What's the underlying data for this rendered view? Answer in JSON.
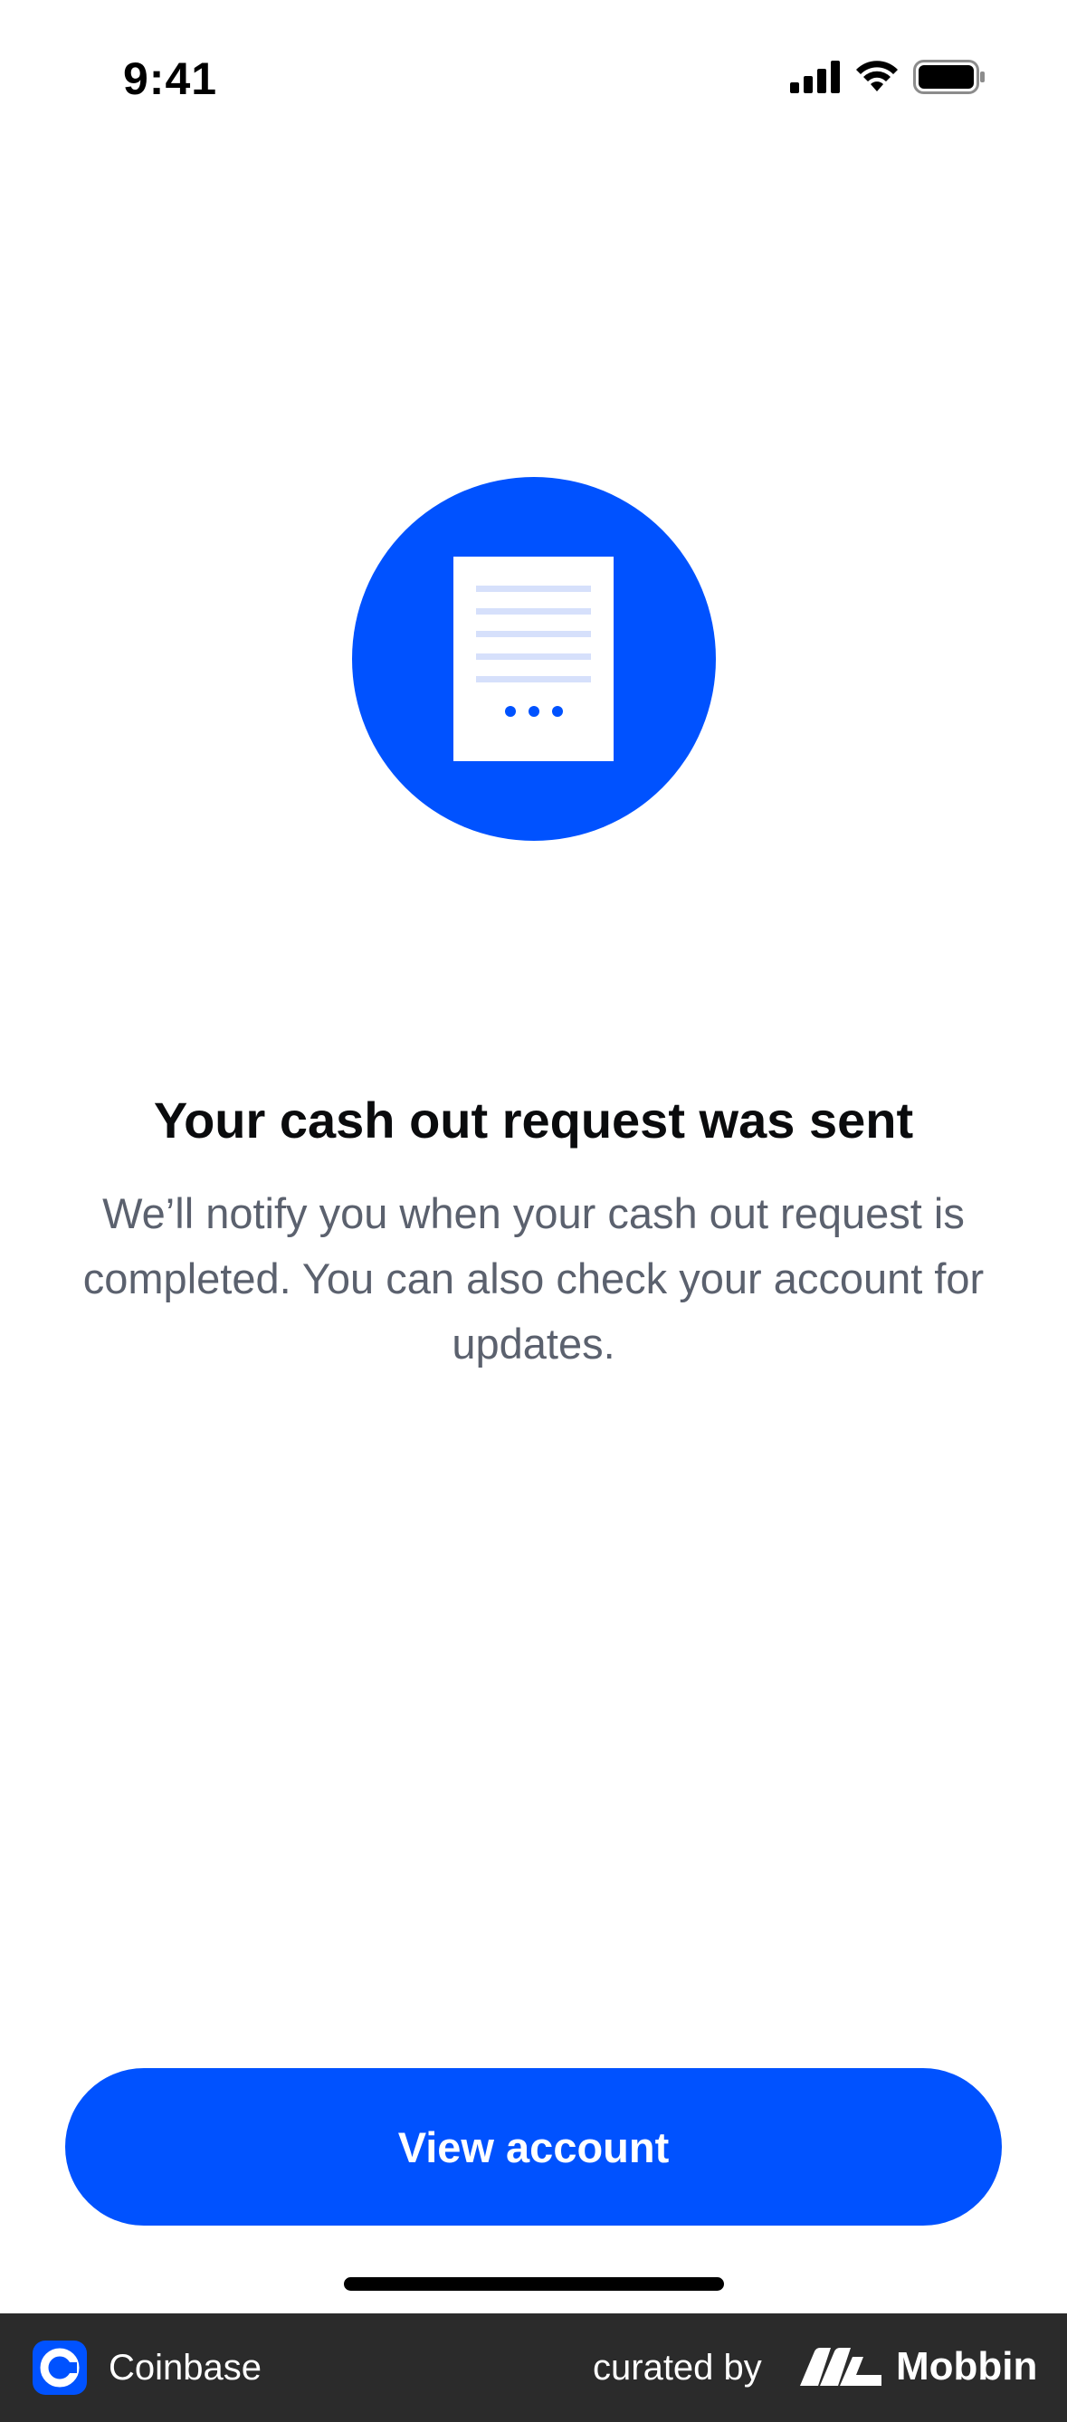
{
  "status_bar": {
    "time": "9:41",
    "icons": [
      "cellular-signal-icon",
      "wifi-icon",
      "battery-icon"
    ]
  },
  "illustration": {
    "icon": "document-pending-icon",
    "accent_color": "#0052ff"
  },
  "main": {
    "title": "Your cash out request was sent",
    "message": "We’ll notify you when your cash out request is completed. You can also check your account for updates."
  },
  "actions": {
    "view_account_label": "View account"
  },
  "footer": {
    "app_name": "Coinbase",
    "curated_by": "curated by",
    "brand_name": "Mobbin",
    "app_icon": "coinbase-logo-icon",
    "brand_icon": "mobbin-logo-icon"
  },
  "colors": {
    "primary": "#0052ff",
    "title_text": "#0a0b0d",
    "body_text": "#5b616e",
    "footer_bg": "#2b2b2b"
  }
}
